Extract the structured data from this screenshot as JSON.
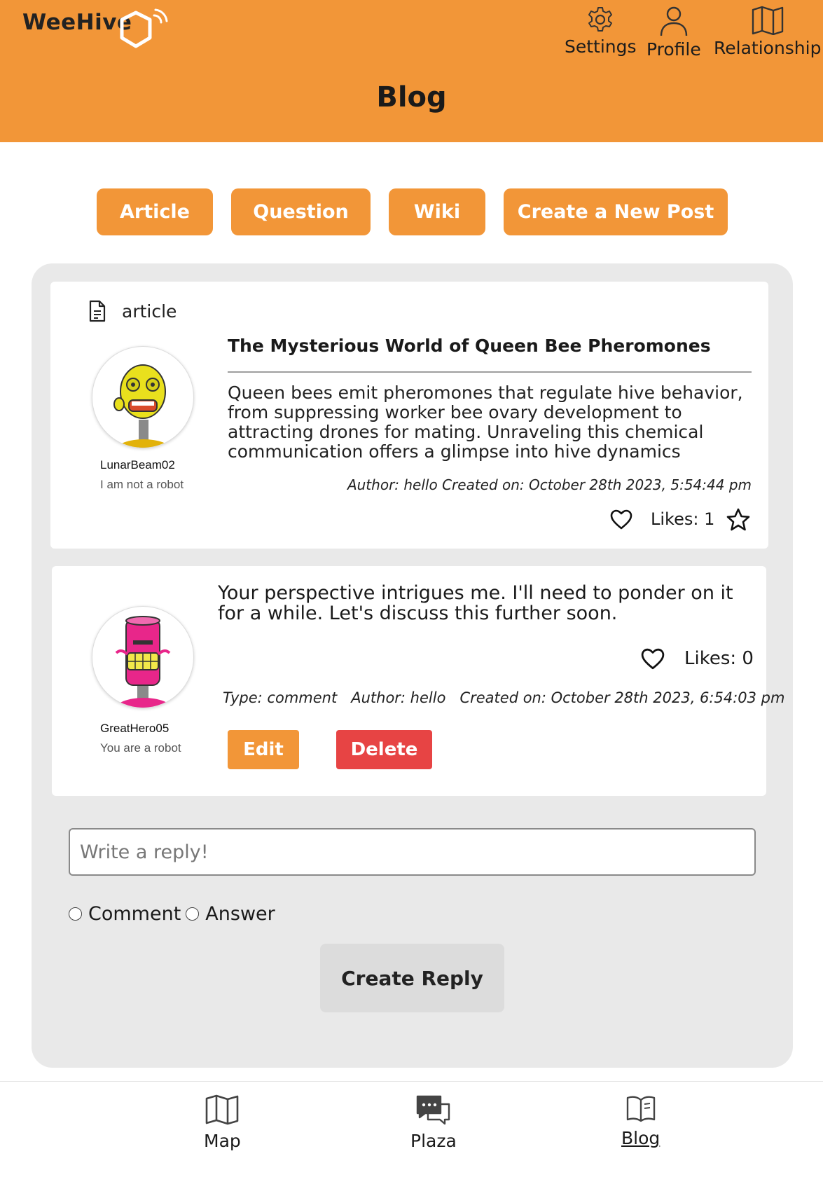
{
  "app": {
    "logo_text": "WeeHive",
    "page_title": "Blog"
  },
  "top_nav": {
    "settings": {
      "label": "Settings",
      "icon": "gear-icon"
    },
    "profile": {
      "label": "Profile",
      "icon": "person-icon"
    },
    "relationship": {
      "label": "Relationship",
      "icon": "map-icon"
    }
  },
  "filters": [
    {
      "label": "Article"
    },
    {
      "label": "Question"
    },
    {
      "label": "Wiki"
    },
    {
      "label": "Create a New Post"
    }
  ],
  "post": {
    "type_label": "article",
    "type_icon": "document-icon",
    "user": {
      "name": "LunarBeam02",
      "status": "I am not a robot"
    },
    "title": "The Mysterious World of Queen Bee Pheromones",
    "body": "Queen bees emit pheromones that regulate hive behavior, from suppressing worker bee ovary development to attracting drones for mating. Unraveling this chemical communication offers a glimpse into hive dynamics",
    "meta": "Author: hello  Created on: October 28th 2023, 5:54:44 pm",
    "likes": "Likes: 1"
  },
  "comment": {
    "user": {
      "name": "GreatHero05",
      "status": "You are a robot"
    },
    "body": "Your perspective intrigues me. I'll need to ponder on it for a while. Let's discuss this further soon.",
    "likes": "Likes: 0",
    "meta": "Type: comment   Author: hello   Created on: October 28th 2023, 6:54:03 pm",
    "edit_label": "Edit",
    "delete_label": "Delete"
  },
  "reply": {
    "placeholder": "Write a reply!",
    "value": "",
    "options": [
      "Comment",
      "Answer"
    ],
    "submit_label": "Create Reply"
  },
  "bottom_nav": [
    {
      "label": "Map",
      "icon": "map-icon",
      "active": false
    },
    {
      "label": "Plaza",
      "icon": "chat-icon",
      "active": false
    },
    {
      "label": "Blog",
      "icon": "book-icon",
      "active": true
    }
  ],
  "colors": {
    "brand": "#f29638",
    "danger": "#e74444",
    "panel": "#e9e9e9"
  }
}
